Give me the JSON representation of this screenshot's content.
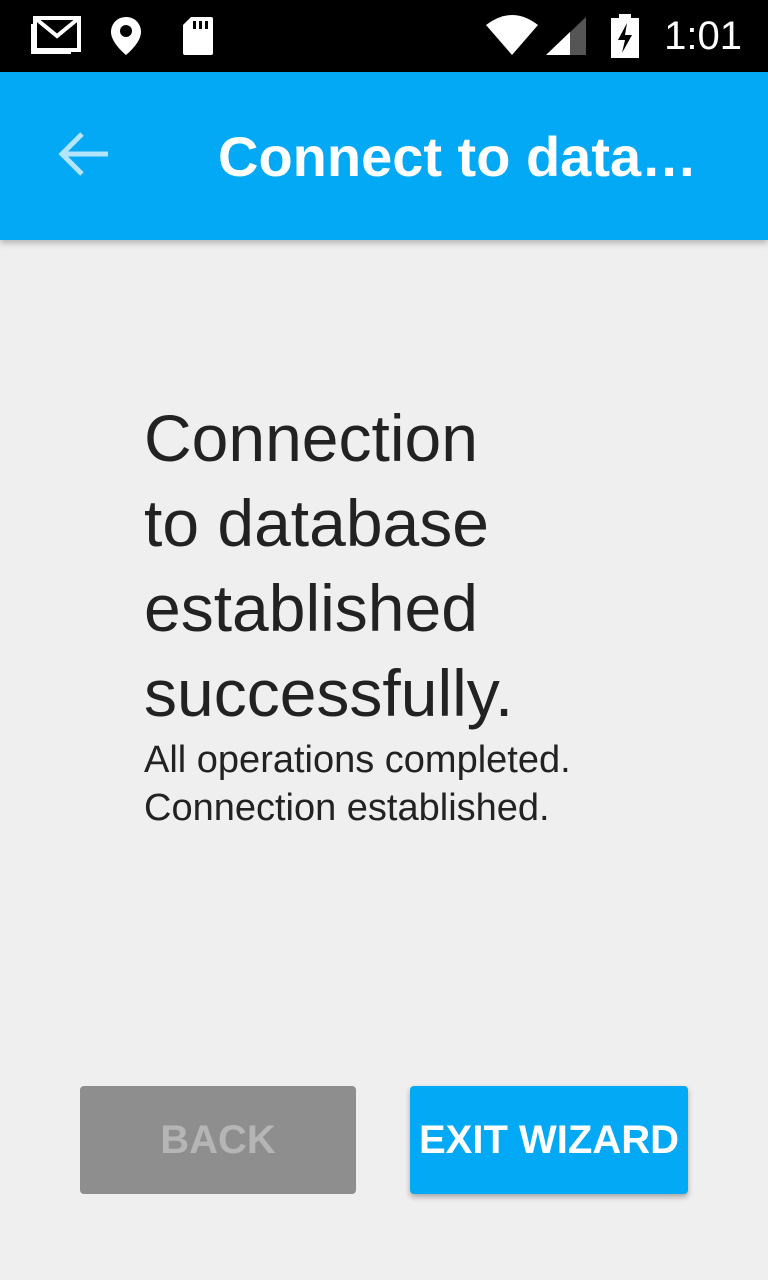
{
  "status_bar": {
    "time": "1:01",
    "icons": [
      "gmail-icon",
      "location-pin-icon",
      "sd-card-icon",
      "wifi-icon",
      "cell-signal-icon",
      "battery-charging-icon"
    ]
  },
  "app_bar": {
    "title": "Connect to datab…",
    "back_icon": "arrow-left-icon"
  },
  "main": {
    "headline_lines": [
      "Connection",
      "to database",
      "established",
      "successfully."
    ],
    "subtext_lines": [
      "All operations completed.",
      "Connection established."
    ]
  },
  "buttons": {
    "back_label": "BACK",
    "exit_label": "EXIT WIZARD"
  },
  "colors": {
    "accent": "#03a9f4",
    "background": "#efefef",
    "disabled_button": "#8e8e8e"
  }
}
